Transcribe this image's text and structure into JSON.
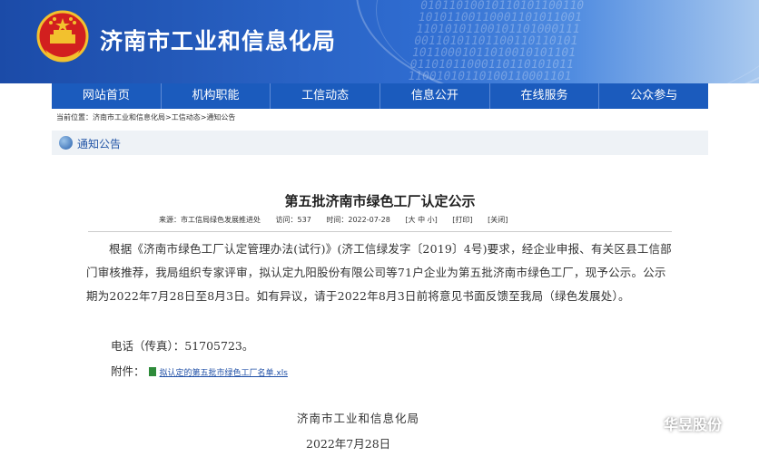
{
  "header": {
    "site_title": "济南市工业和信息化局",
    "binary_pattern": "01011010010110101100110\n10101100110001101011001\n11010101100101101000111\n00110101101100110110101\n10110001011010010101101\n01101011000110110101011\n11001010110100110001101"
  },
  "nav": {
    "items": [
      "网站首页",
      "机构职能",
      "工信动态",
      "信息公开",
      "在线服务",
      "公众参与"
    ]
  },
  "breadcrumb": "当前位置：济南市工业和信息化局>工信动态>通知公告",
  "section_label": "通知公告",
  "article": {
    "title": "第五批济南市绿色工厂认定公示",
    "meta": {
      "source": "来源：市工信局绿色发展推进处",
      "views": "访问：537",
      "time": "时间：2022-07-28",
      "font_size": "[大 中 小]",
      "print": "[打印]",
      "close": "[关闭]"
    },
    "body": "根据《济南市绿色工厂认定管理办法(试行)》(济工信绿发字〔2019〕4号)要求，经企业申报、有关区县工信部门审核推荐，我局组织专家评审，拟认定九阳股份有限公司等71户企业为第五批济南市绿色工厂，现予公示。公示期为2022年7月28日至8月3日。如有异议，请于2022年8月3日前将意见书面反馈至我局（绿色发展处）。",
    "phone": "电话（传真）：51705723。",
    "attachment_label": "附件：",
    "attachment_link": "拟认定的第五批市绿色工厂名单.xls",
    "signature": "济南市工业和信息化局",
    "date": "2022年7月28日"
  },
  "watermark": {
    "text": "华昱股份"
  }
}
